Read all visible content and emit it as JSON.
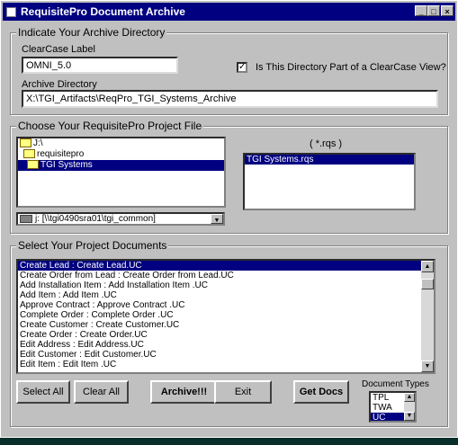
{
  "window": {
    "title": "RequisitePro Document Archive",
    "minimize": "_",
    "maximize": "□",
    "close": "×"
  },
  "archive_group": {
    "legend": "Indicate Your Archive Directory",
    "clearcase_label": "ClearCase Label",
    "clearcase_value": "OMNI_5.0",
    "view_checkbox_label": "Is This Directory Part of a ClearCase View?",
    "view_checkbox_mark": "✓",
    "archive_dir_label": "Archive Directory",
    "archive_dir_value": "X:\\TGI_Artifacts\\ReqPro_TGI_Systems_Archive"
  },
  "project_group": {
    "legend": "Choose Your RequisitePro Project File",
    "folders": [
      "J:\\",
      "requisitepro",
      "TGI Systems"
    ],
    "filter": "( *.rqs )",
    "files": [
      "TGI Systems.rqs"
    ],
    "drive": "j: [\\\\tgi0490sra01\\tgi_common]"
  },
  "documents_group": {
    "legend": "Select Your Project Documents",
    "items": [
      "Create Lead : Create Lead.UC",
      "Create Order from Lead : Create Order from Lead.UC",
      "Add Installation Item : Add Installation Item .UC",
      "Add Item : Add Item .UC",
      "Approve Contract : Approve Contract .UC",
      "Complete Order : Complete Order .UC",
      "Create Customer : Create Customer.UC",
      "Create Order :  Create Order.UC",
      "Edit Address : Edit Address.UC",
      "Edit Customer : Edit Customer.UC",
      "Edit Item : Edit Item .UC"
    ]
  },
  "buttons": {
    "select_all": "Select All",
    "clear_all": "Clear All",
    "archive": "Archive!!!",
    "exit": "Exit",
    "get_docs": "Get Docs"
  },
  "document_types": {
    "label": "Document Types",
    "options": [
      "TPL",
      "TWA",
      "UC"
    ]
  }
}
